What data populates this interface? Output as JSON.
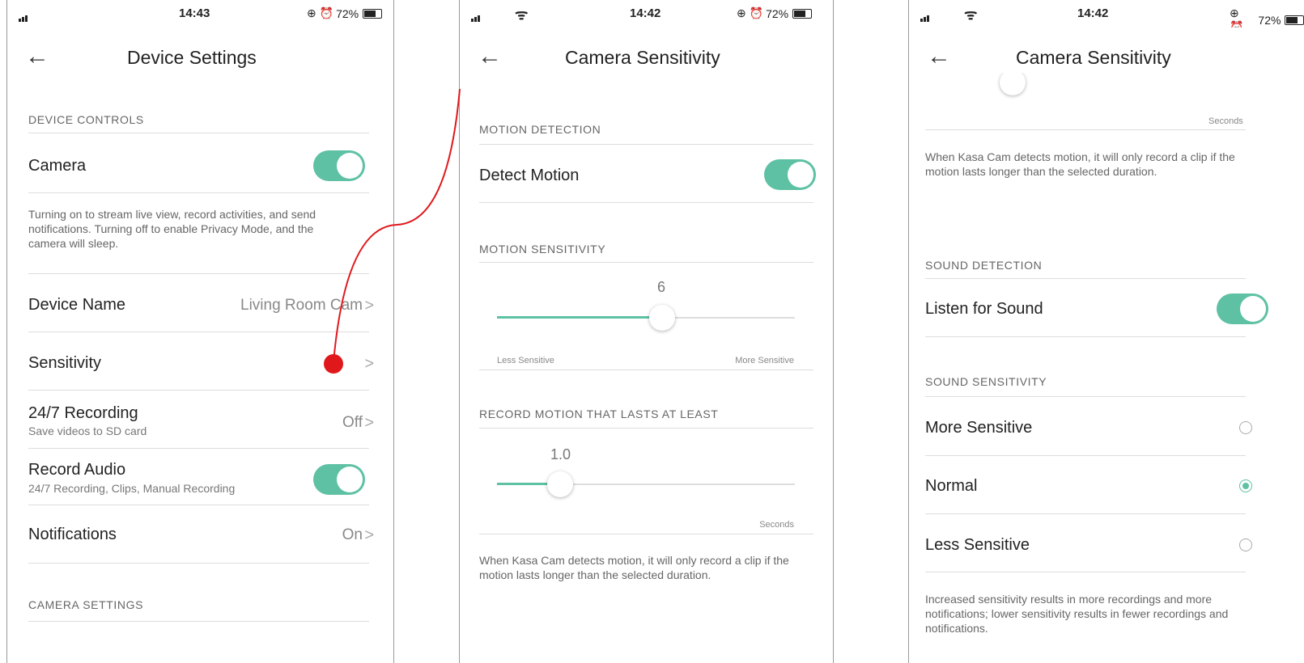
{
  "status_bars": [
    {
      "time": "14:43",
      "battery": "72%"
    },
    {
      "time": "14:42",
      "battery": "72%"
    },
    {
      "time": "14:42",
      "battery": "72%"
    }
  ],
  "colors": {
    "accent": "#5ec1a4",
    "annotation": "#e0181c"
  },
  "screen1": {
    "title": "Device Settings",
    "section_device_controls": "DEVICE CONTROLS",
    "camera_label": "Camera",
    "camera_toggle": true,
    "camera_desc": "Turning on to stream live view, record activities, and send notifications. Turning off to enable Privacy Mode, and the camera will sleep.",
    "device_name_label": "Device Name",
    "device_name_value": "Living Room Cam",
    "sensitivity_label": "Sensitivity",
    "recording_label": "24/7 Recording",
    "recording_sub": "Save videos to SD card",
    "recording_value": "Off",
    "record_audio_label": "Record Audio",
    "record_audio_sub": "24/7 Recording, Clips, Manual Recording",
    "record_audio_toggle": true,
    "notifications_label": "Notifications",
    "notifications_value": "On",
    "section_camera_settings": "CAMERA SETTINGS"
  },
  "screen2": {
    "title": "Camera Sensitivity",
    "section_motion_detection": "MOTION DETECTION",
    "detect_motion_label": "Detect Motion",
    "detect_motion_toggle": true,
    "section_motion_sensitivity": "MOTION SENSITIVITY",
    "motion_sensitivity_value": "6",
    "less_sensitive": "Less Sensitive",
    "more_sensitive": "More Sensitive",
    "section_record_motion": "RECORD MOTION THAT LASTS AT LEAST",
    "record_duration_value": "1.0",
    "seconds_label": "Seconds",
    "duration_desc": "When Kasa Cam detects motion, it will only record a clip if the motion lasts longer than the selected duration."
  },
  "screen3": {
    "title": "Camera Sensitivity",
    "seconds_label": "Seconds",
    "duration_desc": "When Kasa Cam detects motion, it will only record a clip if the motion lasts longer than the selected duration.",
    "section_sound_detection": "SOUND DETECTION",
    "listen_label": "Listen for Sound",
    "listen_toggle": true,
    "section_sound_sensitivity": "SOUND SENSITIVITY",
    "options": [
      "More Sensitive",
      "Normal",
      "Less Sensitive"
    ],
    "selected_option": "Normal",
    "sensitivity_desc": "Increased sensitivity results in more recordings and more notifications; lower sensitivity results in fewer recordings and notifications."
  }
}
